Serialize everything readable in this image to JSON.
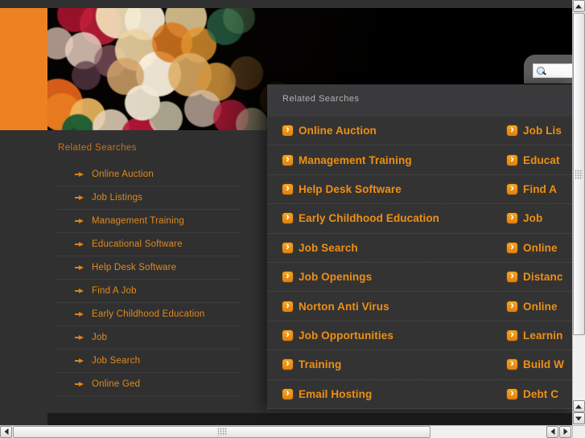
{
  "colors": {
    "page_bg": "#303030",
    "accent_orange": "#ED8223",
    "link_orange": "#E08A1E",
    "overlay_bg": "#333333",
    "overlay_header_bg": "#3A3A3C",
    "overlay_link": "#EF8F14",
    "banner_dark": "#050302"
  },
  "banner": {
    "icon_name": "bokeh-lights-photo",
    "alt": "Blurred colorful bokeh lights on dark background"
  },
  "search": {
    "icon_name": "search-icon",
    "value": "",
    "placeholder": ""
  },
  "sidebar": {
    "heading": "Related Searches",
    "bullet_icon": "arrow-right-icon",
    "items": [
      {
        "label": "Online Auction"
      },
      {
        "label": "Job Listings"
      },
      {
        "label": "Management Training"
      },
      {
        "label": "Educational Software"
      },
      {
        "label": "Help Desk Software"
      },
      {
        "label": "Find A Job"
      },
      {
        "label": "Early Childhood Education"
      },
      {
        "label": "Job"
      },
      {
        "label": "Job Search"
      },
      {
        "label": "Online Ged"
      }
    ]
  },
  "overlay": {
    "heading": "Related Searches",
    "bullet_icon": "chevron-right-box-icon",
    "rows": [
      {
        "left": "Online Auction",
        "right": "Job Lis"
      },
      {
        "left": "Management Training",
        "right": "Educat"
      },
      {
        "left": "Help Desk Software",
        "right": "Find A"
      },
      {
        "left": "Early Childhood Education",
        "right": "Job"
      },
      {
        "left": "Job Search",
        "right": "Online"
      },
      {
        "left": "Job Openings",
        "right": "Distanc"
      },
      {
        "left": "Norton Anti Virus",
        "right": "Online "
      },
      {
        "left": "Job Opportunities",
        "right": "Learnin"
      },
      {
        "left": "Training",
        "right": "Build W"
      },
      {
        "left": "Email Hosting",
        "right": "Debt C"
      }
    ]
  },
  "scrollbars": {
    "vertical": {
      "up_icon": "triangle-up-icon",
      "down_icon": "triangle-down-icon",
      "thumb_name": "vertical-scroll-thumb"
    },
    "horizontal": {
      "left_icon": "triangle-left-icon",
      "right_icon": "triangle-right-icon",
      "thumb_name": "horizontal-scroll-thumb"
    }
  }
}
